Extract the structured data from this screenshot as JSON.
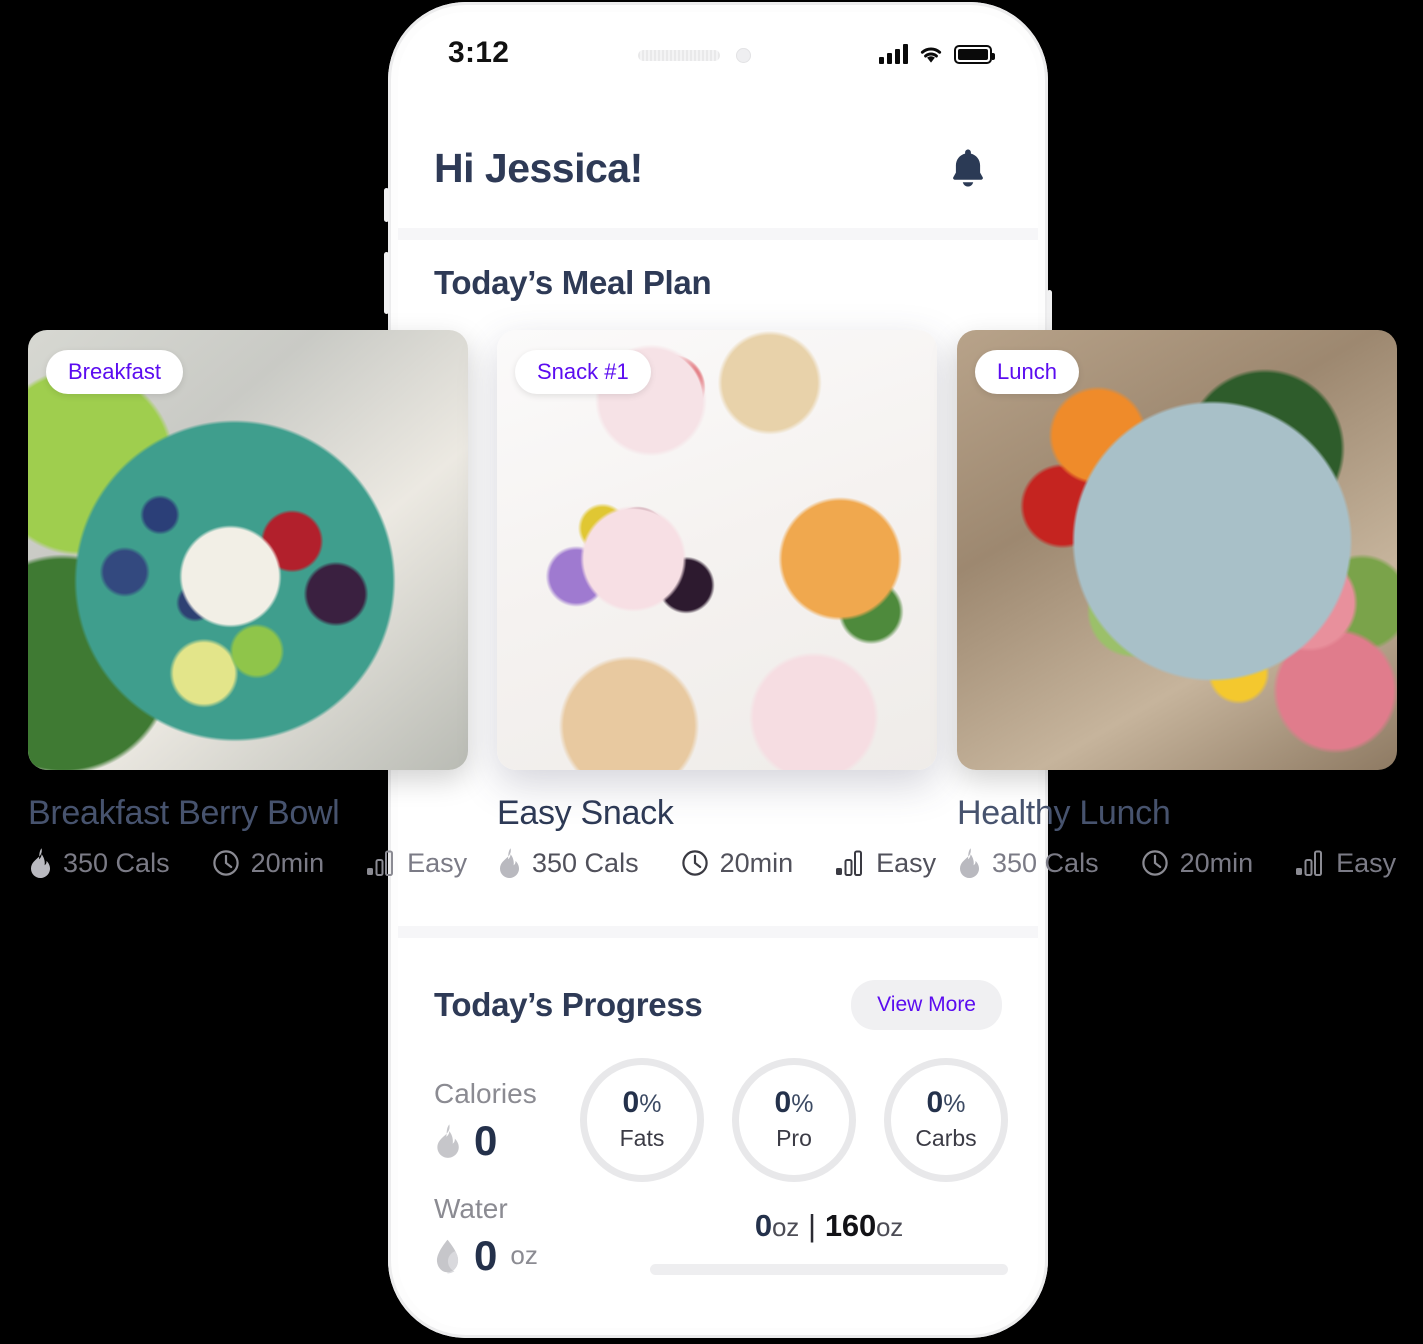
{
  "status_bar": {
    "time": "3:12",
    "signal_icon": "signal-bars-icon",
    "wifi_icon": "wifi-icon",
    "battery_icon": "battery-icon"
  },
  "header": {
    "greeting": "Hi Jessica!",
    "notification_icon": "bell-icon"
  },
  "meal_plan": {
    "title": "Today’s Meal Plan",
    "cards": [
      {
        "badge": "Breakfast",
        "title": "Breakfast Berry Bowl",
        "calories": "350 Cals",
        "time": "20min",
        "difficulty": "Easy",
        "calories_icon": "flame-icon",
        "time_icon": "clock-icon",
        "difficulty_icon": "bar-chart-icon"
      },
      {
        "badge": "Snack #1",
        "title": "Easy Snack",
        "calories": "350 Cals",
        "time": "20min",
        "difficulty": "Easy",
        "calories_icon": "flame-icon",
        "time_icon": "clock-icon",
        "difficulty_icon": "bar-chart-icon"
      },
      {
        "badge": "Lunch",
        "title": "Healthy Lunch",
        "calories": "350 Cals",
        "time": "20min",
        "difficulty": "Easy",
        "calories_icon": "flame-icon",
        "time_icon": "clock-icon",
        "difficulty_icon": "bar-chart-icon"
      }
    ]
  },
  "progress": {
    "title": "Today’s Progress",
    "view_more_label": "View More",
    "calories": {
      "label": "Calories",
      "value": "0",
      "icon": "flame-icon"
    },
    "rings": [
      {
        "percent": "0",
        "unit": "%",
        "name": "Fats"
      },
      {
        "percent": "0",
        "unit": "%",
        "name": "Pro"
      },
      {
        "percent": "0",
        "unit": "%",
        "name": "Carbs"
      }
    ],
    "water": {
      "label": "Water",
      "value": "0",
      "unit": "oz",
      "icon": "water-drop-icon",
      "current": "0",
      "current_unit": "oz",
      "separator": "|",
      "goal": "160",
      "goal_unit": "oz",
      "fill_percent": 0
    }
  },
  "colors": {
    "accent_purple": "#5b0cf0",
    "heading_navy": "#2e3a56",
    "muted_text": "#8b8b92",
    "track_gray": "#e8e8ea",
    "page_background": "#000000"
  }
}
